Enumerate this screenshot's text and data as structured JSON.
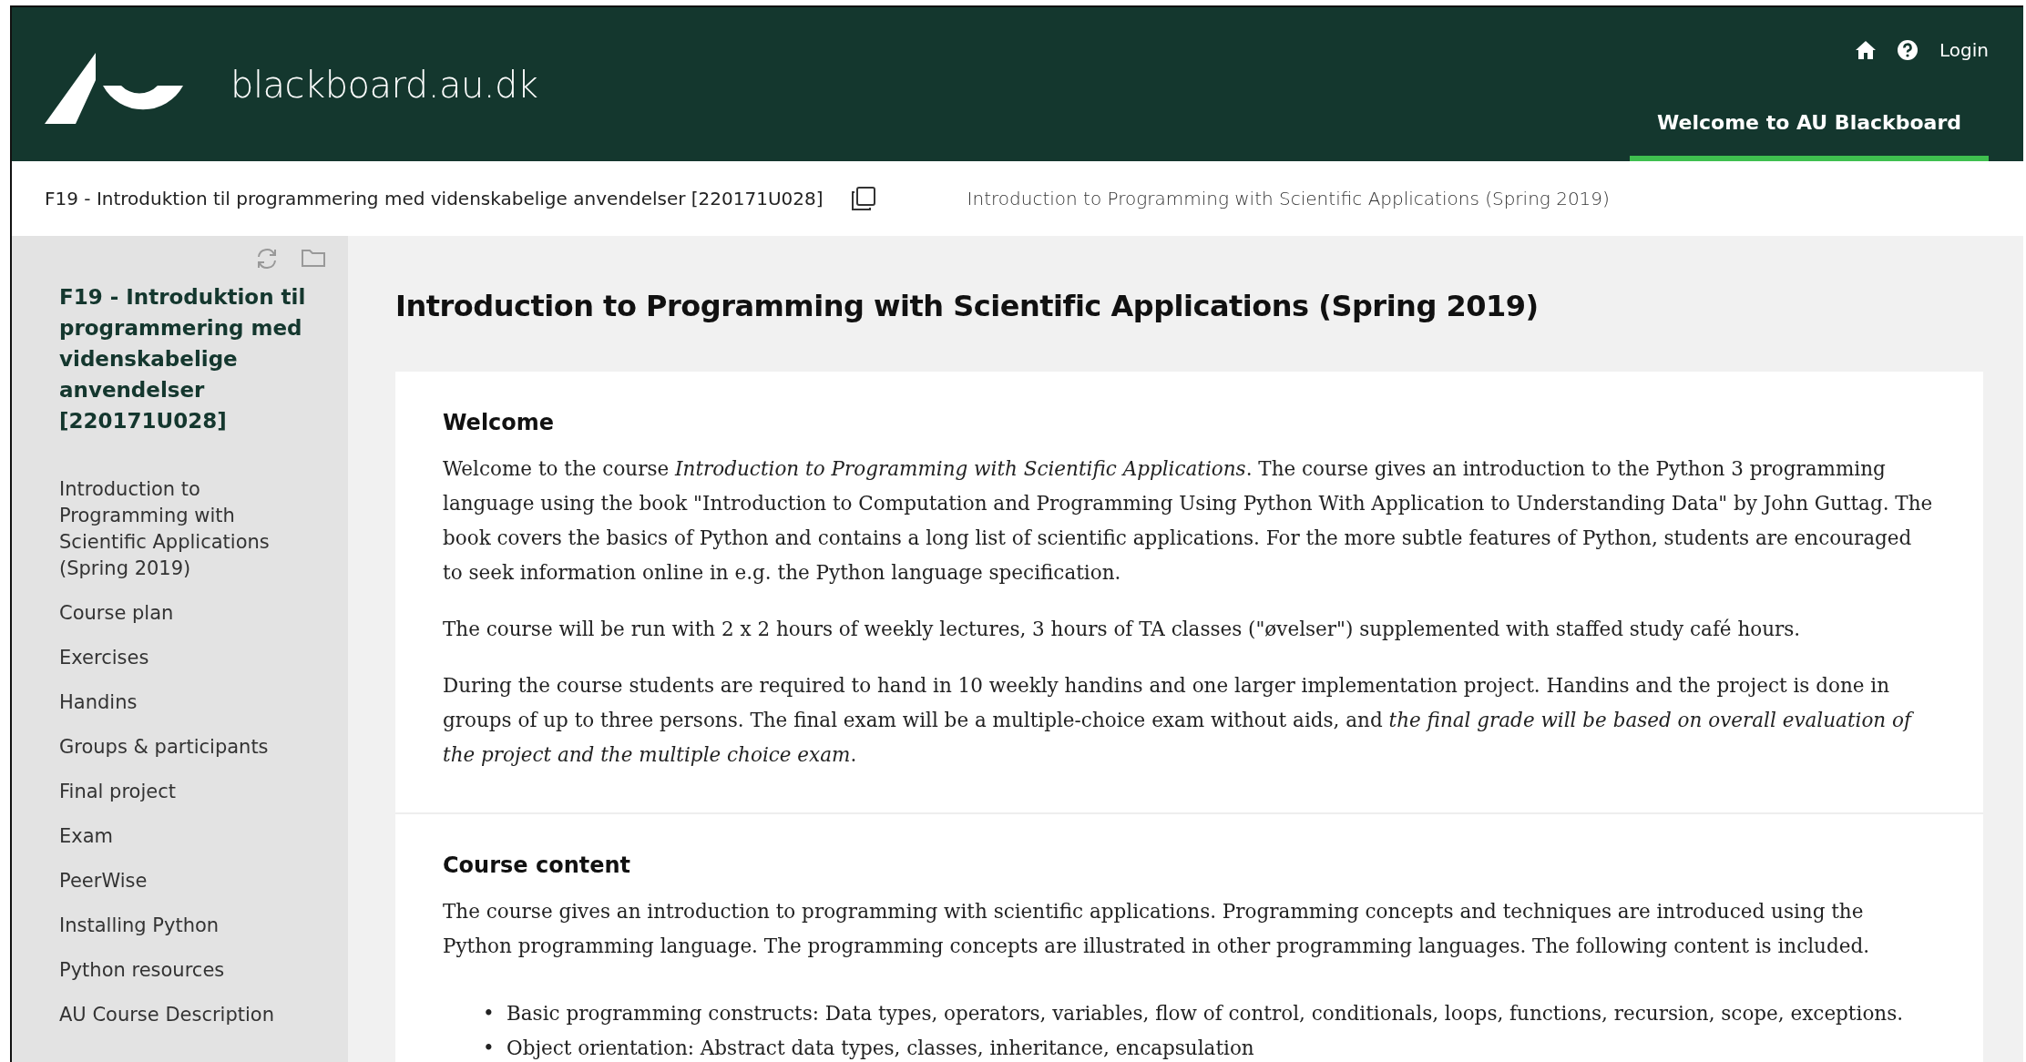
{
  "header": {
    "site": "blackboard.au.dk",
    "login": "Login",
    "tabs": [
      {
        "label": "Welcome to AU Blackboard",
        "selected": true
      }
    ]
  },
  "breadcrumb": {
    "course": "F19 - Introduktion til programmering med videnskabelige anvendelser [220171U028]",
    "page": "Introduction to Programming with Scientific Applications (Spring 2019)"
  },
  "sidebar": {
    "title": "F19 - Introduktion til programmering med videnskabelige anvendelser [220171U028]",
    "items": [
      {
        "label": "Introduction to Programming with Scientific Applications (Spring 2019)"
      },
      {
        "label": "Course plan"
      },
      {
        "label": "Exercises"
      },
      {
        "label": "Handins"
      },
      {
        "label": "Groups & participants"
      },
      {
        "label": "Final project"
      },
      {
        "label": "Exam"
      },
      {
        "label": "PeerWise"
      },
      {
        "label": "Installing Python"
      },
      {
        "label": "Python resources"
      },
      {
        "label": "AU Course Description"
      }
    ]
  },
  "main": {
    "title": "Introduction to Programming with Scientific Applications (Spring 2019)",
    "sections": [
      {
        "heading": "Welcome",
        "blocks": [
          {
            "kind": "paragraph",
            "text": "Welcome to the course *Introduction to Programming with Scientific Applications*. The course gives an introduction to the Python 3 programming language using the book \"Introduction to Computation and Programming Using Python With Application to Understanding Data\" by John Guttag. The book covers the basics of Python and contains a long list of scientific applications. For the more subtle features of Python, students are encouraged to seek information online in e.g. the Python language specification."
          },
          {
            "kind": "paragraph",
            "text": "The course will be run with 2 x 2 hours of weekly lectures, 3 hours of TA classes (\"øvelser\") supplemented with staffed study café hours."
          },
          {
            "kind": "paragraph",
            "text": "During the course students are required to hand in 10 weekly handins and one larger implementation project. Handins and the project is done in groups of up to three persons. The final exam will be a multiple-choice exam without aids, and *the final grade will be based on overall evaluation of the project and the multiple choice exam*."
          }
        ]
      },
      {
        "heading": "Course content",
        "blocks": [
          {
            "kind": "paragraph",
            "text": "The course gives an introduction to programming with scientific applications. Programming concepts and techniques are introduced using the Python programming language. The programming concepts are illustrated in other programming languages. The following content is included."
          },
          {
            "kind": "list",
            "items": [
              {
                "marker": "•",
                "text": "Basic programming constructs: Data types, operators, variables, flow of control, conditionals, loops, functions, recursion, scope, exceptions."
              },
              {
                "marker": "•",
                "text": "Object orientation: Abstract data types, classes, inheritance, encapsulation"
              }
            ]
          }
        ]
      }
    ]
  }
}
